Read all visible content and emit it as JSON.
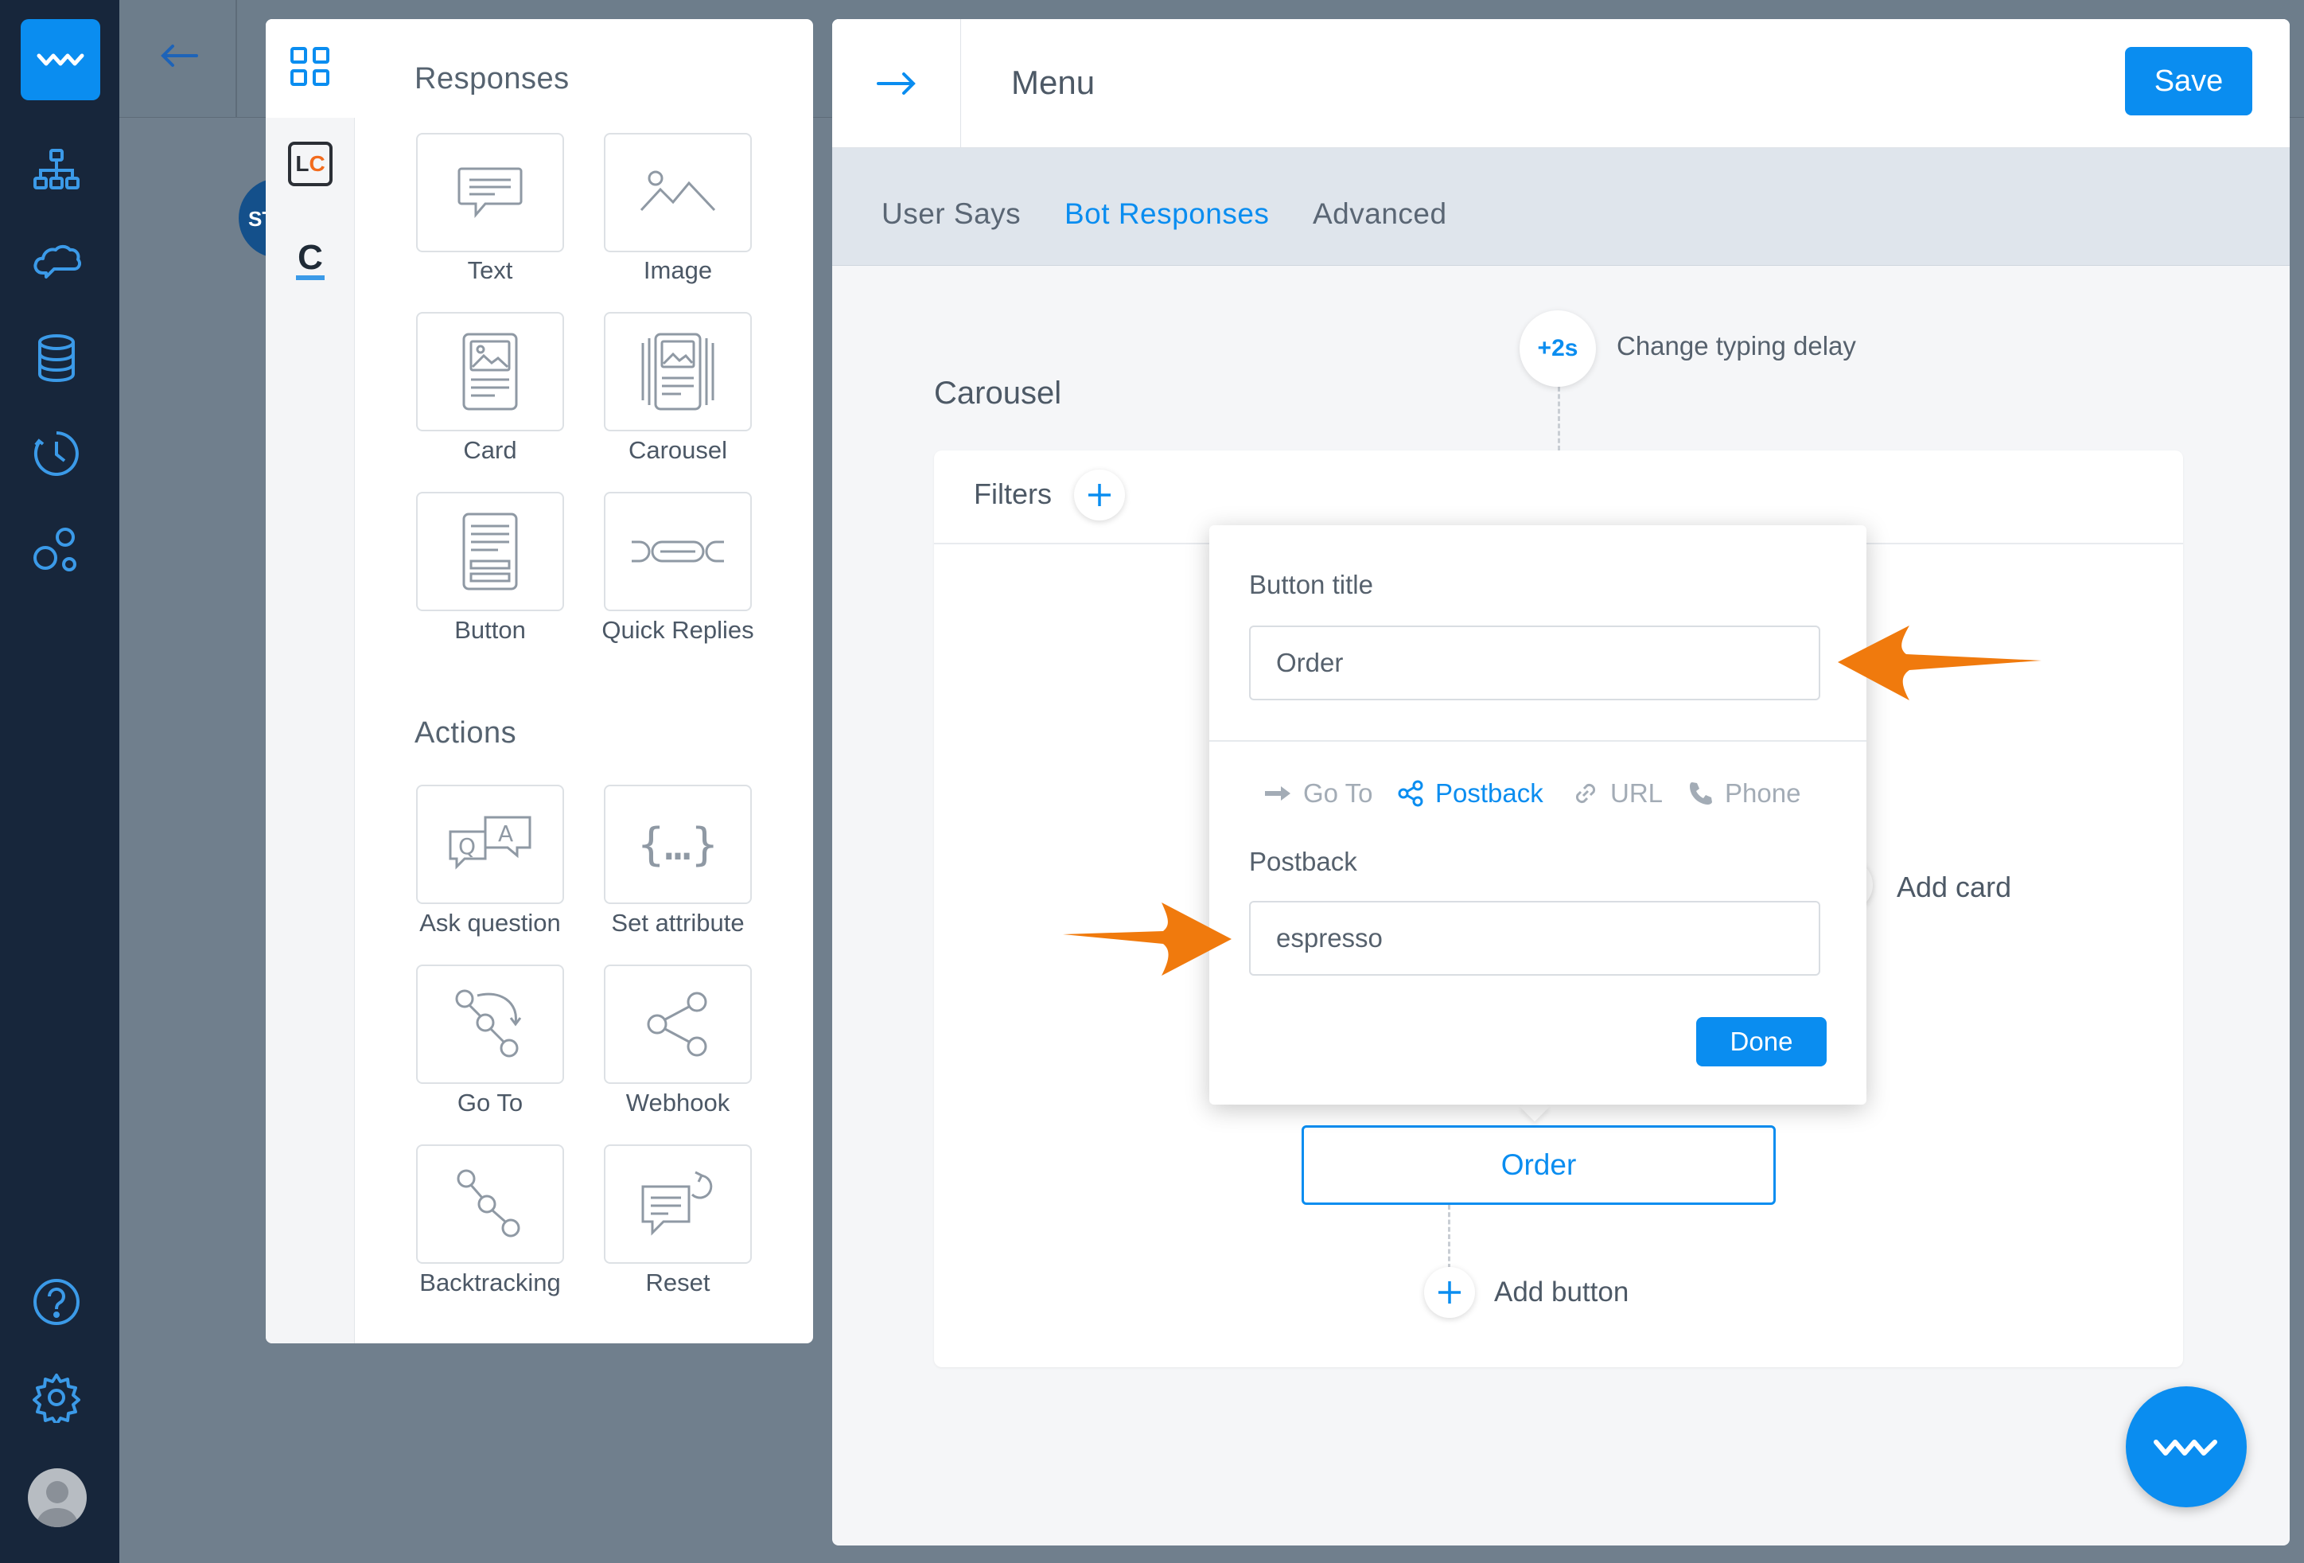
{
  "nav": {
    "icons": [
      "logo-wave-icon",
      "structure-icon",
      "training-cloud-icon",
      "database-icon",
      "history-clock-icon",
      "integrations-bubbles-icon",
      "help-icon",
      "settings-gear-icon"
    ]
  },
  "background": {
    "bubble_text": "ST"
  },
  "responses_panel": {
    "responses_title": "Responses",
    "responses": [
      {
        "label": "Text",
        "icon": "text-message-icon"
      },
      {
        "label": "Image",
        "icon": "image-icon"
      },
      {
        "label": "Card",
        "icon": "card-icon"
      },
      {
        "label": "Carousel",
        "icon": "carousel-icon"
      },
      {
        "label": "Button",
        "icon": "button-icon"
      },
      {
        "label": "Quick Replies",
        "icon": "quick-replies-icon"
      }
    ],
    "actions_title": "Actions",
    "actions": [
      {
        "label": "Ask question",
        "icon": "ask-question-icon"
      },
      {
        "label": "Set attribute",
        "icon": "set-attribute-icon"
      },
      {
        "label": "Go To",
        "icon": "go-to-icon"
      },
      {
        "label": "Webhook",
        "icon": "webhook-icon"
      },
      {
        "label": "Backtracking",
        "icon": "backtracking-icon"
      },
      {
        "label": "Reset",
        "icon": "reset-icon"
      }
    ],
    "rail_lc": "LC",
    "rail_c": "C"
  },
  "editor": {
    "title": "Menu",
    "save_label": "Save",
    "tabs": [
      {
        "label": "User Says",
        "active": false
      },
      {
        "label": "Bot Responses",
        "active": true
      },
      {
        "label": "Advanced",
        "active": false
      }
    ],
    "typing_delay_badge": "+2s",
    "typing_delay_label": "Change typing delay",
    "block_title": "Carousel",
    "filters_label": "Filters",
    "add_card_label": "Add card",
    "order_button_label": "Order",
    "add_button_label": "Add button"
  },
  "popup": {
    "button_title_label": "Button title",
    "button_title_value": "Order",
    "option_tabs": [
      {
        "label": "Go To",
        "active": false,
        "icon": "arrow-right-icon"
      },
      {
        "label": "Postback",
        "active": true,
        "icon": "share-nodes-icon"
      },
      {
        "label": "URL",
        "active": false,
        "icon": "link-icon"
      },
      {
        "label": "Phone",
        "active": false,
        "icon": "phone-icon"
      }
    ],
    "postback_label": "Postback",
    "postback_value": "espresso",
    "done_label": "Done"
  },
  "colors": {
    "accent": "#0a8df0",
    "sidebar": "#17263b",
    "annotation_arrow": "#f07a0d"
  }
}
